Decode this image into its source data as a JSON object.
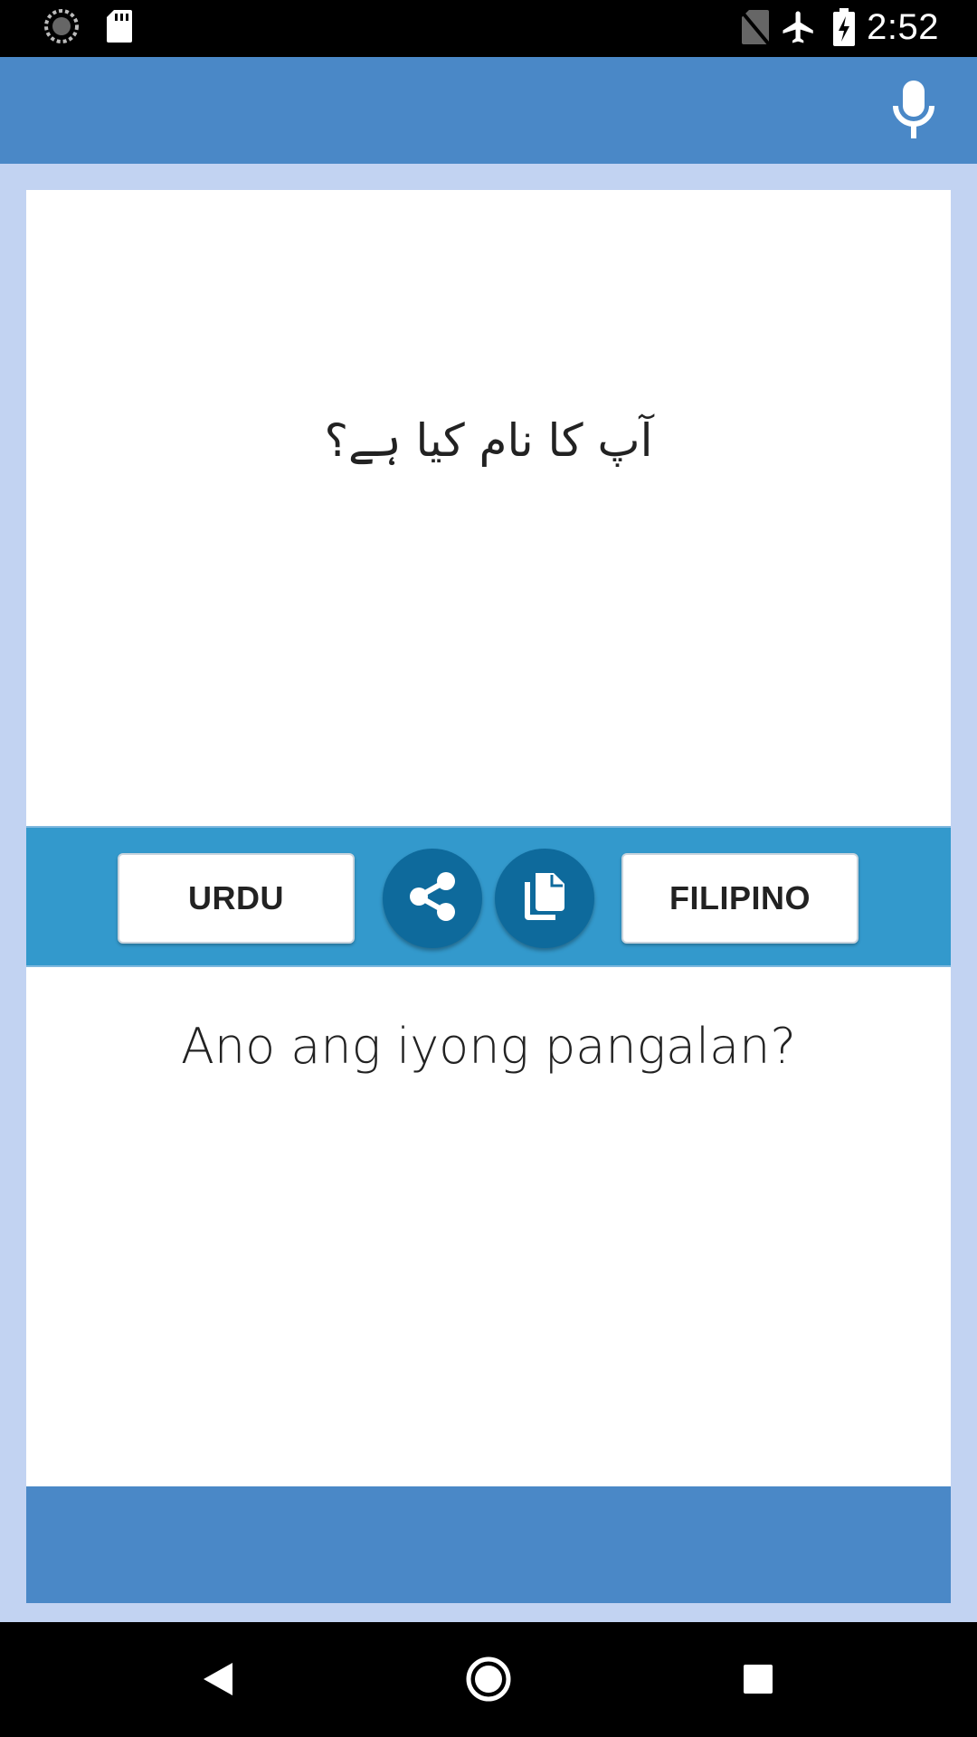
{
  "status_bar": {
    "time": "2:52",
    "icons": [
      "sync-icon",
      "sd-card-icon",
      "no-sim-icon",
      "airplane-mode-icon",
      "battery-charging-icon"
    ]
  },
  "app_bar": {
    "mic_icon": "microphone-icon"
  },
  "translation": {
    "source_text": "آپ کا نام کیا ہے؟",
    "target_text": "Ano ang iyong pangalan?"
  },
  "toolbar": {
    "source_language": "URDU",
    "target_language": "FILIPINO",
    "share_icon": "share-icon",
    "copy_icon": "copy-icon"
  },
  "nav_bar": {
    "icons": [
      "back-icon",
      "home-icon",
      "recents-icon"
    ]
  },
  "colors": {
    "app_bar": "#4a88c7",
    "background": "#c2d3f2",
    "toolbar": "#3399cc",
    "round_button": "#0e6a9c"
  }
}
